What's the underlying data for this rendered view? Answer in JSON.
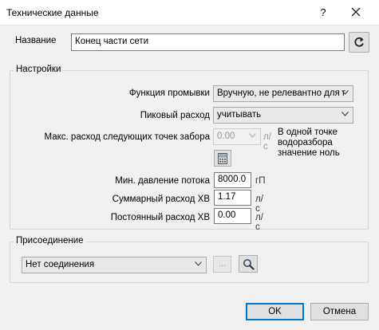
{
  "window": {
    "title": "Технические данные",
    "help_label": "?",
    "close_label": "✕"
  },
  "name": {
    "label": "Название",
    "value": "Конец части сети"
  },
  "settings": {
    "group_label": "Настройки",
    "flush_function": {
      "label": "Функция промывки",
      "value": "Вручную, не релевантно для г"
    },
    "peak_flow": {
      "label": "Пиковый расход",
      "value": "учитывать"
    },
    "max_flow_next": {
      "label": "Макс. расход следующих точек забора",
      "value": "0.00",
      "unit": "л/с"
    },
    "note": "В одной точке водоразбора значение ноль",
    "min_pressure": {
      "label": "Мин. давление потока",
      "value": "8000.0",
      "unit": "гП"
    },
    "total_cold_flow": {
      "label": "Суммарный расход ХВ",
      "value": "1.17",
      "unit": "л/с"
    },
    "constant_cold_flow": {
      "label": "Постоянный расход ХВ",
      "value": "0.00",
      "unit": "л/с"
    }
  },
  "connection": {
    "group_label": "Присоединение",
    "value": "Нет соединения",
    "browse_label": "..."
  },
  "footer": {
    "ok_label": "OK",
    "cancel_label": "Отмена"
  },
  "icons": {
    "refresh": "refresh-icon",
    "calculator": "calculator-icon",
    "search": "search-icon",
    "dropdown": "chevron-down-icon"
  }
}
